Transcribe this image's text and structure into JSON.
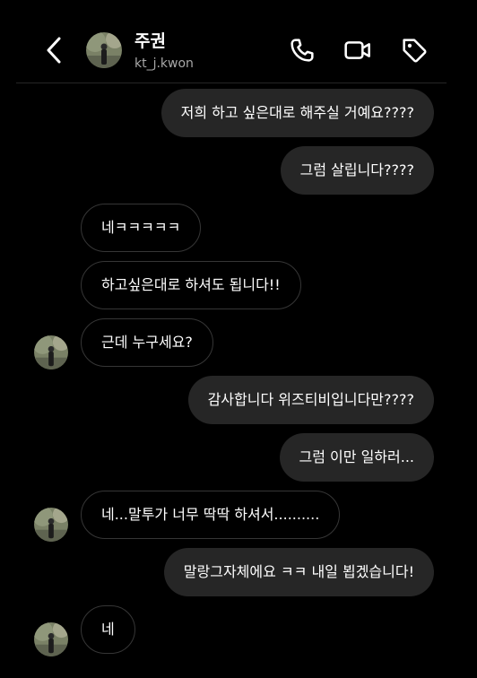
{
  "header": {
    "name": "주권",
    "username": "kt_j.kwon"
  },
  "icons": {
    "back": "chevron-left-icon",
    "call": "phone-icon",
    "video": "video-camera-icon",
    "tag": "tag-icon"
  },
  "colors": {
    "background": "#000000",
    "sent_bubble": "#262626",
    "received_border": "#363636",
    "secondary_text": "#a8a8a8"
  },
  "messages": [
    {
      "from": "me",
      "text": "저희 하고 싶은대로 해주실 거예요????"
    },
    {
      "from": "me",
      "text": "그럼 살립니다????"
    },
    {
      "from": "them",
      "text": "네ㅋㅋㅋㅋㅋ"
    },
    {
      "from": "them",
      "text": "하고싶은대로 하셔도 됩니다!!"
    },
    {
      "from": "them",
      "text": "근데 누구세요?"
    },
    {
      "from": "me",
      "text": "감사합니다 위즈티비입니다만????"
    },
    {
      "from": "me",
      "text": "그럼 이만 일하러..."
    },
    {
      "from": "them",
      "text": "네...말투가 너무 딱딱 하셔서.........."
    },
    {
      "from": "me",
      "text": "말랑그자체에요 ㅋㅋ 내일 뵙겠습니다!"
    },
    {
      "from": "them",
      "text": "네"
    }
  ]
}
